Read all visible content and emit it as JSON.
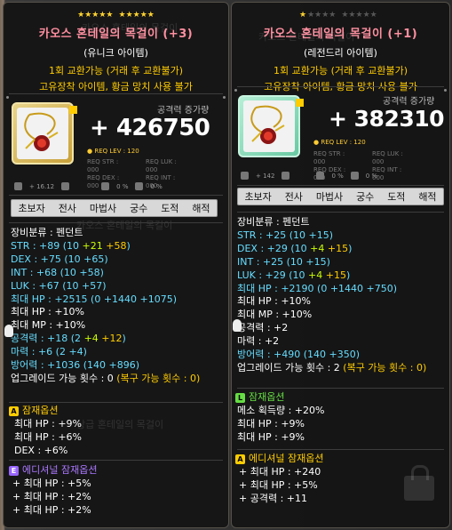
{
  "items": [
    {
      "stars_on": 10,
      "stars_off": 0,
      "title": "카오스 혼테일의 목걸이 (+3)",
      "rarity": "(유니크 아이템)",
      "trade": "1회 교환가능 (거래 후 교환불가)",
      "restrict": "고유장착 아이템, 황금 망치 사용 불가",
      "attack_label": "공격력 증가량",
      "attack_gain": "+ 426750",
      "req_lev": "REQ LEV : 120",
      "req_str": "REQ STR : 000",
      "req_luk": "REQ LUK : 000",
      "req_dex": "REQ DEX : 000",
      "req_int": "REQ INT : 000",
      "small_num": "+ 16.12",
      "small_pct1": "0 %",
      "small_pct2": "0 %",
      "jobs": [
        "초보자",
        "전사",
        "마법사",
        "궁수",
        "도적",
        "해적"
      ],
      "category": "장비분류 : 펜던트",
      "stats": [
        {
          "label": "STR : +89 (10 ",
          "g": "+21",
          "y": " +58",
          "end": ")"
        },
        {
          "label": "DEX : +75 (10 +65)",
          "g": "",
          "y": "",
          "end": ""
        },
        {
          "label": "INT : +68 (10 +58)",
          "g": "",
          "y": "",
          "end": ""
        },
        {
          "label": "LUK : +67 (10 +57)",
          "g": "",
          "y": "",
          "end": ""
        },
        {
          "label": "최대 HP : +2515 (0 +1440 +1075)",
          "g": "",
          "y": "",
          "end": ""
        },
        {
          "label": "최대 HP : +10%",
          "g": "",
          "y": "",
          "end": ""
        },
        {
          "label": "최대 MP : +10%",
          "g": "",
          "y": "",
          "end": ""
        },
        {
          "label": "공격력 : +18 (2 ",
          "g": "+4",
          "y": " +12",
          "end": ")"
        },
        {
          "label": "마력 : +6 (2 +4)",
          "g": "",
          "y": "",
          "end": ""
        },
        {
          "label": "방어력 : +1036 (140 +896)",
          "g": "",
          "y": "",
          "end": ""
        }
      ],
      "upgrade": "업그레이드 가능 횟수 : 0 ",
      "upgrade_restore": "(복구 가능 횟수 : 0)",
      "potential_title": "잠재옵션",
      "potential": [
        "최대 HP : +9%",
        "최대 HP : +6%",
        "DEX : +6%"
      ],
      "additional_title": "에디셔널 잠재옵션",
      "additional": [
        "+ 최대 HP : +5%",
        "+ 최대 HP : +2%",
        "+ 최대 HP : +2%"
      ]
    },
    {
      "stars_on": 1,
      "stars_off": 9,
      "title": "카오스 혼테일의 목걸이 (+1)",
      "rarity": "(레전드리 아이템)",
      "trade": "1회 교환가능 (거래 후 교환불가)",
      "restrict": "고유장착 아이템, 황금 망치 사용 불가",
      "attack_label": "공격력 증가량",
      "attack_gain": "+ 382310",
      "req_lev": "REQ LEV : 120",
      "req_str": "REQ STR : 000",
      "req_luk": "REQ LUK : 000",
      "req_dex": "REQ DEX : 000",
      "req_int": "REQ INT : 000",
      "small_num": "+ 142",
      "small_pct1": "0 %",
      "small_pct2": "0 %",
      "jobs": [
        "초보자",
        "전사",
        "마법사",
        "궁수",
        "도적",
        "해적"
      ],
      "category": "장비분류 : 펜던트",
      "stats": [
        {
          "label": "STR : +25 (10 +15)",
          "g": "",
          "y": "",
          "end": ""
        },
        {
          "label": "DEX : +29 (10 ",
          "g": "+4",
          "y": " +15",
          "end": ")"
        },
        {
          "label": "INT : +25 (10 +15)",
          "g": "",
          "y": "",
          "end": ""
        },
        {
          "label": "LUK : +29 (10 ",
          "g": "+4",
          "y": " +15",
          "end": ")"
        },
        {
          "label": "최대 HP : +2190 (0 +1440 +750)",
          "g": "",
          "y": "",
          "end": ""
        },
        {
          "label": "최대 HP : +10%",
          "g": "",
          "y": "",
          "end": ""
        },
        {
          "label": "최대 MP : +10%",
          "g": "",
          "y": "",
          "end": ""
        },
        {
          "label": "공격력 : +2",
          "g": "",
          "y": "",
          "end": ""
        },
        {
          "label": "마력 : +2",
          "g": "",
          "y": "",
          "end": ""
        },
        {
          "label": "방어력 : +490 (140 +350)",
          "g": "",
          "y": "",
          "end": ""
        }
      ],
      "upgrade": "업그레이드 가능 횟수 : 2 ",
      "upgrade_restore": "(복구 가능 횟수 : 0)",
      "potential_title": "잠재옵션",
      "potential": [
        "메소 획득량 : +20%",
        "최대 HP : +9%",
        "최대 HP : +9%"
      ],
      "additional_title": "에디셔널 잠재옵션",
      "additional": [
        "+ 최대 HP : +240",
        "+ 최대 HP : +5%",
        "+ 공격력 : +11"
      ]
    }
  ],
  "ghost_text": [
    "카오스 혼테일의 목걸이",
    "상급 혼테일의 목걸이"
  ],
  "colors": {
    "title": "#ff8fa0",
    "trade": "#ffcc00",
    "stat_blue": "#66ddff",
    "green": "#ccff00",
    "violet": "#aa77ff"
  }
}
